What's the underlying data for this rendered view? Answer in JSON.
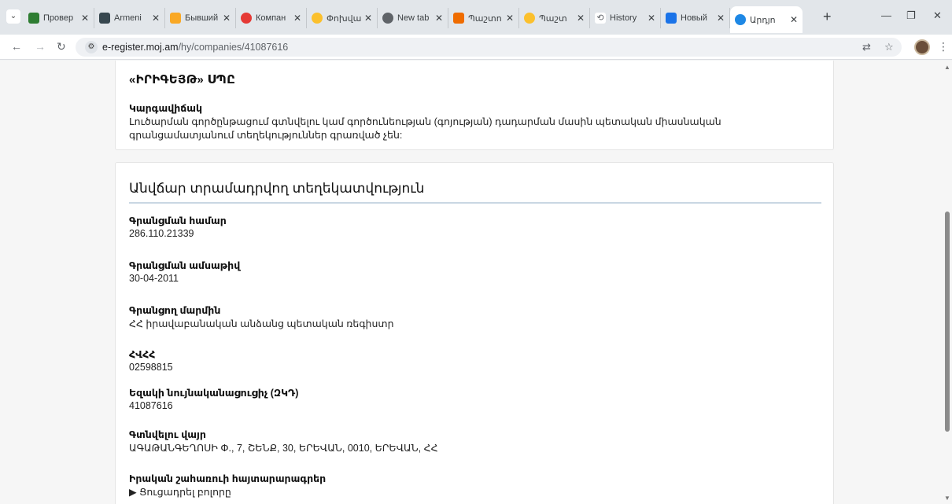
{
  "browser": {
    "tabs": [
      {
        "label": "Провер",
        "favicon_color": "#2e7d32"
      },
      {
        "label": "Armeni",
        "favicon_color": "#37474f"
      },
      {
        "label": "Бывший",
        "favicon_color": "#f9a825"
      },
      {
        "label": "Компан",
        "favicon_color": "#e53935"
      },
      {
        "label": "Փոխվա",
        "favicon_color": "#fbc02d"
      },
      {
        "label": "New tab",
        "favicon_color": "#5f6368"
      },
      {
        "label": "Պաշտո",
        "favicon_color": "#ef6c00"
      },
      {
        "label": "Պաշտ",
        "favicon_color": "#fbc02d"
      },
      {
        "label": "History",
        "favicon_color": "#5f6368"
      },
      {
        "label": "Новый ",
        "favicon_color": "#1a73e8"
      },
      {
        "label": "Արդյո",
        "favicon_color": "#1e88e5"
      }
    ],
    "active_tab_index": 10,
    "close_glyph": "✕",
    "new_tab_glyph": "+",
    "url_host": "e-register.moj.am",
    "url_path": "/hy/companies/41087616"
  },
  "company": {
    "name": "«ԻՐԻԳԵՅԹ» ՍՊԸ",
    "status_label": "Կարգավիճակ",
    "status_text": "Լուծարման գործընթացում գտնվելու կամ գործունեության (գոյության) դադարման մասին պետական միասնական գրանցամատյանում տեղեկություններ գրառված չեն:"
  },
  "info": {
    "title": "Անվճար տրամադրվող տեղեկատվություն",
    "fields": [
      {
        "label": "Գրանցման համար",
        "value": "286.110.21339"
      },
      {
        "label": "Գրանցման ամսաթիվ",
        "value": "30-04-2011"
      },
      {
        "label": "Գրանցող մարմին",
        "value": "ՀՀ իրավաբանական անձանց պետական ռեգիստր"
      },
      {
        "label": "ՀՎՀՀ",
        "value": "02598815"
      },
      {
        "label": "Եզակի նույնականացուցիչ (ԶԿԴ)",
        "value": "41087616"
      },
      {
        "label": "Գտնվելու վայր",
        "value": "ԱԳԱԹԱՆԳԵՂՈՍԻ Փ., 7, ՇԵՆՔ, 30, ԵՐԵՎԱՆ, 0010, ԵՐԵՎԱՆ, ՀՀ"
      }
    ],
    "beneficial_owner_label": "Իրական շահառուի հայտարարագրեր",
    "show_all": "▶ Ցուցադրել բոլորը"
  }
}
